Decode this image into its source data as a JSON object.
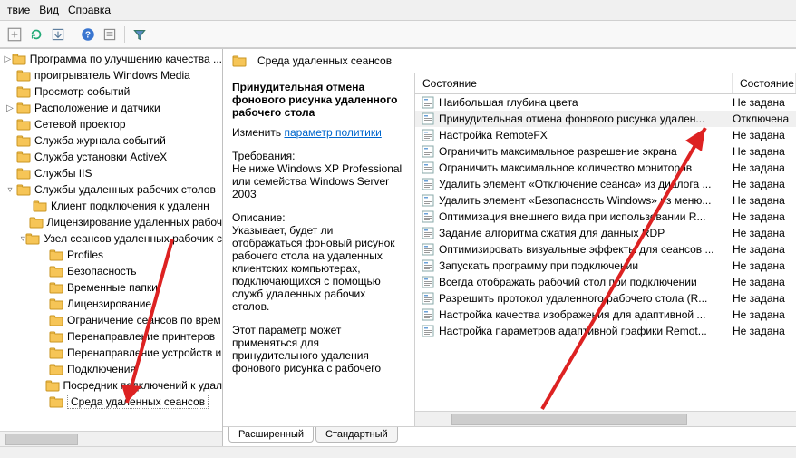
{
  "menu": {
    "items": [
      "твие",
      "Вид",
      "Справка"
    ]
  },
  "toolbar": {
    "icons": [
      "expand-icon",
      "refresh-icon",
      "export-icon",
      "help-icon",
      "properties-icon",
      "filter-icon"
    ]
  },
  "tree": {
    "items": [
      {
        "indent": 0,
        "twisty": "▷",
        "label": "Программа по улучшению качества ...",
        "truncated": true
      },
      {
        "indent": 0,
        "twisty": "",
        "label": "проигрыватель Windows Media"
      },
      {
        "indent": 0,
        "twisty": "",
        "label": "Просмотр событий"
      },
      {
        "indent": 0,
        "twisty": "▷",
        "label": "Расположение и датчики"
      },
      {
        "indent": 0,
        "twisty": "",
        "label": "Сетевой проектор"
      },
      {
        "indent": 0,
        "twisty": "",
        "label": "Служба журнала событий"
      },
      {
        "indent": 0,
        "twisty": "",
        "label": "Служба установки ActiveX"
      },
      {
        "indent": 0,
        "twisty": "",
        "label": "Службы IIS"
      },
      {
        "indent": 0,
        "twisty": "▿",
        "label": "Службы удаленных рабочих столов"
      },
      {
        "indent": 1,
        "twisty": "",
        "label": "Клиент подключения к удаленн"
      },
      {
        "indent": 1,
        "twisty": "",
        "label": "Лицензирование удаленных рабоч"
      },
      {
        "indent": 1,
        "twisty": "▿",
        "label": "Узел сеансов удаленных рабочих с"
      },
      {
        "indent": 2,
        "twisty": "",
        "label": "Profiles"
      },
      {
        "indent": 2,
        "twisty": "",
        "label": "Безопасность"
      },
      {
        "indent": 2,
        "twisty": "",
        "label": "Временные папки"
      },
      {
        "indent": 2,
        "twisty": "",
        "label": "Лицензирование"
      },
      {
        "indent": 2,
        "twisty": "",
        "label": "Ограничение сеансов по врем"
      },
      {
        "indent": 2,
        "twisty": "",
        "label": "Перенаправление принтеров"
      },
      {
        "indent": 2,
        "twisty": "",
        "label": "Перенаправление устройств и"
      },
      {
        "indent": 2,
        "twisty": "",
        "label": "Подключения"
      },
      {
        "indent": 2,
        "twisty": "",
        "label": "Посредник подключений к удал"
      },
      {
        "indent": 2,
        "twisty": "",
        "label": "Среда удаленных сеансов",
        "selected": true
      }
    ]
  },
  "header": {
    "title": "Среда удаленных сеансов"
  },
  "description": {
    "title": "Принудительная отмена фонового рисунка удаленного рабочего стола",
    "edit_prefix": "Изменить ",
    "edit_link": "параметр политики",
    "req_label": "Требования:",
    "req_text": "Не ниже Windows XP Professional или семейства Windows Server 2003",
    "desc_label": "Описание:",
    "desc_text": "Указывает, будет ли отображаться фоновый рисунок рабочего стола на удаленных клиентских компьютерах, подключающихся с помощью служб удаленных рабочих столов.",
    "desc_text2": "Этот параметр может применяться для принудительного удаления фонового рисунка с рабочего"
  },
  "columns": {
    "name": "Состояние",
    "state": "Состояние"
  },
  "policies": [
    {
      "name": "Наибольшая глубина цвета",
      "state": "Не задана"
    },
    {
      "name": "Принудительная отмена фонового рисунка удален...",
      "state": "Отключена",
      "selected": true
    },
    {
      "name": "Настройка RemoteFX",
      "state": "Не задана"
    },
    {
      "name": "Ограничить максимальное разрешение экрана",
      "state": "Не задана"
    },
    {
      "name": "Ограничить максимальное количество мониторов",
      "state": "Не задана"
    },
    {
      "name": "Удалить элемент «Отключение сеанса» из диалога ...",
      "state": "Не задана"
    },
    {
      "name": "Удалить элемент «Безопасность Windows» из меню...",
      "state": "Не задана"
    },
    {
      "name": "Оптимизация внешнего вида при использовании R...",
      "state": "Не задана"
    },
    {
      "name": "Задание алгоритма сжатия для данных RDP",
      "state": "Не задана"
    },
    {
      "name": "Оптимизировать визуальные эффекты для сеансов ...",
      "state": "Не задана"
    },
    {
      "name": "Запускать программу при подключении",
      "state": "Не задана"
    },
    {
      "name": "Всегда отображать рабочий стол при подключении",
      "state": "Не задана"
    },
    {
      "name": "Разрешить протокол удаленного рабочего стола (R...",
      "state": "Не задана"
    },
    {
      "name": "Настройка качества изображения для адаптивной ...",
      "state": "Не задана"
    },
    {
      "name": "Настройка параметров адаптивной графики Remot...",
      "state": "Не задана"
    }
  ],
  "tabs": {
    "extended": "Расширенный",
    "standard": "Стандартный"
  }
}
